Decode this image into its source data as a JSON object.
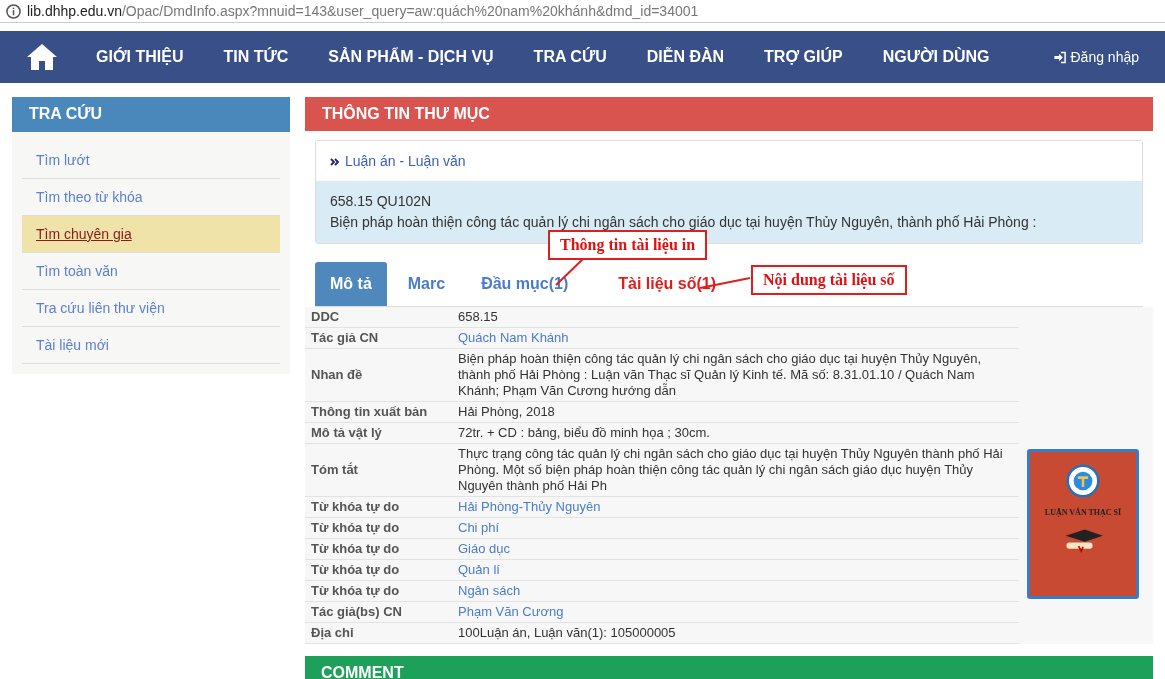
{
  "address_bar": {
    "host": "lib.dhhp.edu.vn",
    "path": "/Opac/DmdInfo.aspx?mnuid=143&user_query=aw:quách%20nam%20khánh&dmd_id=34001"
  },
  "nav": {
    "items": [
      "GIỚI THIỆU",
      "TIN TỨC",
      "SẢN PHẨM - DỊCH VỤ",
      "TRA CỨU",
      "DIỄN ĐÀN",
      "TRỢ GIÚP",
      "NGƯỜI DÙNG"
    ],
    "login": "Đăng nhập"
  },
  "sidebar": {
    "title": "TRA CỨU",
    "items": [
      {
        "label": "Tìm lướt",
        "selected": false
      },
      {
        "label": "Tìm theo từ khóa",
        "selected": false
      },
      {
        "label": "Tìm chuyên gia",
        "selected": true
      },
      {
        "label": "Tìm toàn văn",
        "selected": false
      },
      {
        "label": "Tra cứu liên thư viện",
        "selected": false
      },
      {
        "label": "Tài liệu mới",
        "selected": false
      }
    ]
  },
  "record": {
    "title": "THÔNG TIN THƯ MỤC",
    "category": "Luận án - Luận văn",
    "call_number": "658.15 QU102N",
    "short_title": "Biện pháp hoàn thiện công tác quản lý chi ngân sách cho giáo dục tại huyện Thủy Nguyên, thành phố Hải Phòng :",
    "tabs": [
      {
        "label": "Mô tả",
        "selected": true,
        "highlighted": false
      },
      {
        "label": "Marc",
        "selected": false,
        "highlighted": false
      },
      {
        "label": "Đầu mục(1)",
        "selected": false,
        "highlighted": false
      },
      {
        "label": "Tài liệu số(1)",
        "selected": false,
        "highlighted": true
      }
    ],
    "annotations": [
      "Thông tin tài liệu in",
      "Nội dung tài liệu số"
    ],
    "fields": [
      {
        "label": "DDC",
        "value": "658.15",
        "kind": "text"
      },
      {
        "label": "Tác giả CN",
        "value": "Quách Nam Khánh",
        "kind": "link"
      },
      {
        "label": "Nhan đề",
        "value": "Biện pháp hoàn thiện công tác quản lý chi ngân sách cho giáo dục tại huyện Thủy Nguyên, thành phố Hải Phòng : Luận văn Thạc sĩ Quản lý Kinh tế. Mã số: 8.31.01.10 / Quách Nam Khánh; Phạm Văn Cương hướng dẫn",
        "kind": "text"
      },
      {
        "label": "Thông tin xuất bản",
        "value": "Hải Phòng, 2018",
        "kind": "text"
      },
      {
        "label": "Mô tả vật lý",
        "value": "72tr. + CD : bảng, biểu đồ minh họa ; 30cm.",
        "kind": "text"
      },
      {
        "label": "Tóm tắt",
        "value": "Thực trạng công tác quản lý chi ngân sách cho giáo dục tại huyện Thủy Nguyên thành phố Hải Phòng. Một số biện pháp hoàn thiện công tác quản lý chi ngân sách giáo dục huyện Thủy Nguyên thành phố Hải Ph",
        "kind": "text"
      },
      {
        "label": "Từ khóa tự do",
        "value": "Hải Phòng-Thủy Nguyên",
        "kind": "link"
      },
      {
        "label": "Từ khóa tự do",
        "value": "Chi phí",
        "kind": "link"
      },
      {
        "label": "Từ khóa tự do",
        "value": "Giáo dục",
        "kind": "link"
      },
      {
        "label": "Từ khóa tự do",
        "value": "Quản lí",
        "kind": "link"
      },
      {
        "label": "Từ khóa tự do",
        "value": "Ngân sách",
        "kind": "link"
      },
      {
        "label": "Tác giả(bs) CN",
        "value": "Phạm Văn Cương",
        "kind": "link"
      },
      {
        "label": "Địa chỉ",
        "value": "100Luận án, Luận văn(1): 105000005",
        "kind": "text"
      }
    ],
    "cover_title": "LUẬN VĂN THẠC SĨ"
  },
  "comment": {
    "title": "COMMENT"
  }
}
